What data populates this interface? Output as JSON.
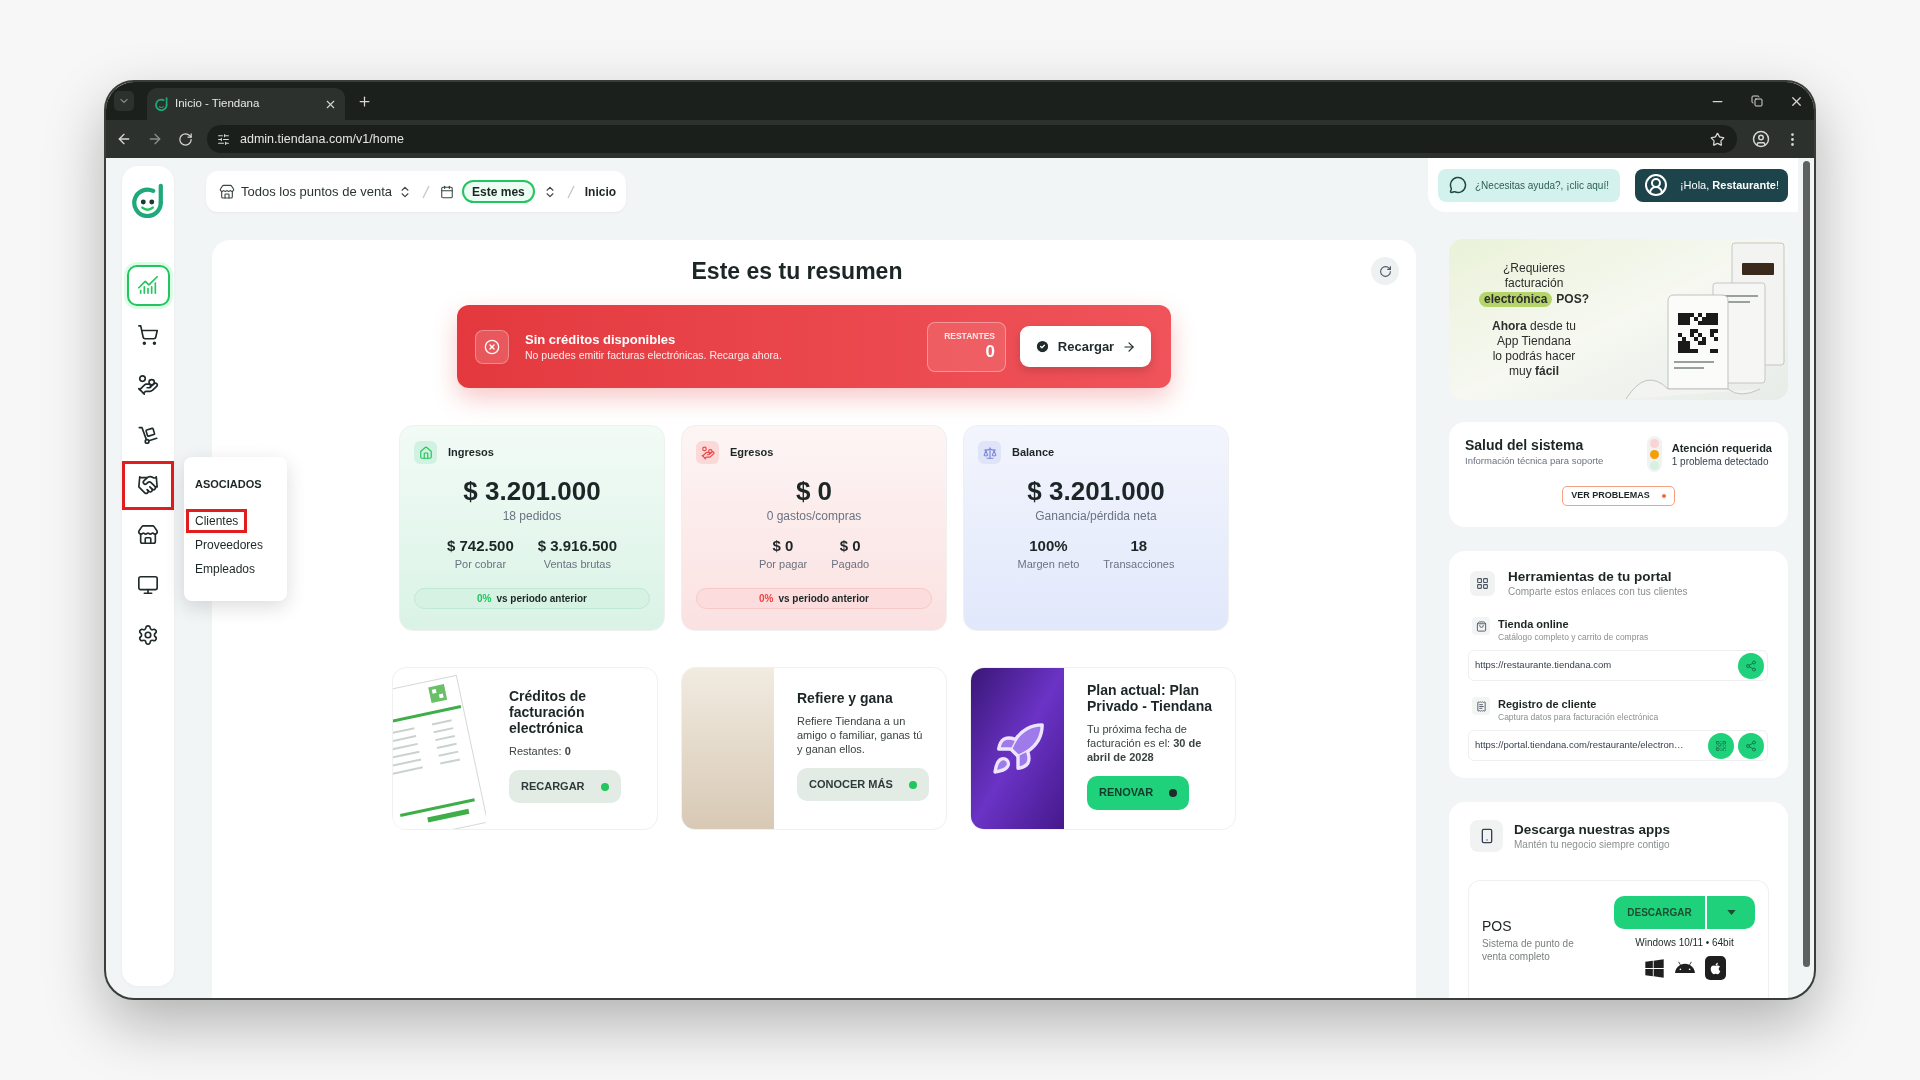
{
  "browser": {
    "tab_title": "Inicio - Tiendana",
    "address": "admin.tiendana.com/v1/home"
  },
  "breadcrumb": {
    "store_filter": "Todos los puntos de venta",
    "period": "Este mes",
    "current_page": "Inicio"
  },
  "header": {
    "help": "¿Necesitas ayuda?, ¡clic aquí!",
    "greeting": "¡Hola, **Restaurante**!"
  },
  "sidebar": {
    "items": [
      {
        "selected": true,
        "highlighted": false
      },
      {
        "selected": false,
        "highlighted": false
      },
      {
        "selected": false,
        "highlighted": false
      },
      {
        "selected": false,
        "highlighted": false
      },
      {
        "selected": false,
        "highlighted": true
      },
      {
        "selected": false,
        "highlighted": false
      },
      {
        "selected": false,
        "highlighted": false
      },
      {
        "selected": false,
        "highlighted": false
      }
    ]
  },
  "submenu": {
    "title": "ASOCIADOS",
    "items": [
      {
        "label": "Clientes",
        "highlighted": true
      },
      {
        "label": "Proveedores",
        "highlighted": false
      },
      {
        "label": "Empleados",
        "highlighted": false
      }
    ]
  },
  "summary": {
    "title": "Este es tu resumen",
    "alert": {
      "title": "Sin créditos disponibles",
      "message": "No puedes emitir facturas electrónicas. Recarga ahora.",
      "counter_label": "RESTANTES",
      "counter_value": "0",
      "action": "Recargar"
    },
    "stats": [
      {
        "kind": "income",
        "label": "Ingresos",
        "value": "$ 3.201.000",
        "caption": "18 pedidos",
        "details": [
          {
            "value": "$ 742.500",
            "label": "Por cobrar"
          },
          {
            "value": "$ 3.916.500",
            "label": "Ventas brutas"
          }
        ],
        "change": "0%",
        "change_label": "vs periodo anterior"
      },
      {
        "kind": "expense",
        "label": "Egresos",
        "value": "$ 0",
        "caption": "0 gastos/compras",
        "details": [
          {
            "value": "$ 0",
            "label": "Por pagar"
          },
          {
            "value": "$ 0",
            "label": "Pagado"
          }
        ],
        "change": "0%",
        "change_label": "vs periodo anterior"
      },
      {
        "kind": "balance",
        "label": "Balance",
        "value": "$ 3.201.000",
        "caption": "Ganancia/pérdida neta",
        "details": [
          {
            "value": "100%",
            "label": "Margen neto"
          },
          {
            "value": "18",
            "label": "Transacciones"
          }
        ]
      }
    ],
    "promos": [
      {
        "kind": "invoice",
        "title": "Créditos de facturación electrónica",
        "text": "Restantes: **0**",
        "button": {
          "label": "RECARGAR",
          "kind": "soft"
        }
      },
      {
        "kind": "photo",
        "title": "Refiere y gana",
        "text": "Refiere Tiendana a un amigo o familiar, ganas tú y ganan ellos.",
        "button": {
          "label": "CONOCER MÁS",
          "kind": "soft"
        }
      },
      {
        "kind": "illustration",
        "title": "Plan actual: Plan Privado - Tiendana",
        "text": "Tu próxima fecha de facturación es el: **30 de abril de 2028**",
        "button": {
          "label": "RENOVAR",
          "kind": "solid"
        }
      }
    ]
  },
  "right_panel": {
    "banner": {
      "question": "¿Requieres facturación",
      "highlight": "electrónica",
      "question_end": "POS?",
      "text": "**Ahora** desde tu App Tiendana lo podrás hacer muy **fácil**"
    },
    "health": {
      "title": "Salud del sistema",
      "subtitle": "Información técnica para soporte",
      "lights": [
        {
          "on": false
        },
        {
          "on": true
        },
        {
          "on": false
        }
      ],
      "status_title": "Atención requerida",
      "status_detail": "1 problema detectado",
      "button": "VER PROBLEMAS"
    },
    "tools": {
      "title": "Herramientas de tu portal",
      "subtitle": "Comparte estos enlaces con tus clientes",
      "links": [
        {
          "title": "Tienda online",
          "subtitle": "Catálogo completo y carrito de compras",
          "url": "https://restaurante.tiendana.com",
          "actions": [
            {
              "kind": "share"
            }
          ]
        },
        {
          "title": "Registro de cliente",
          "subtitle": "Captura datos para facturación electrónica",
          "url": "https://portal.tiendana.com/restaurante/electron…",
          "actions": [
            {
              "kind": "qr"
            },
            {
              "kind": "share"
            }
          ]
        }
      ]
    },
    "apps": {
      "title": "Descarga nuestras apps",
      "subtitle": "Mantén tu negocio siempre contigo",
      "items": [
        {
          "name": "POS",
          "description": "Sistema de punto de venta completo",
          "button": "DESCARGAR",
          "requirements": "Windows 10/11 • 64bit"
        }
      ]
    }
  }
}
